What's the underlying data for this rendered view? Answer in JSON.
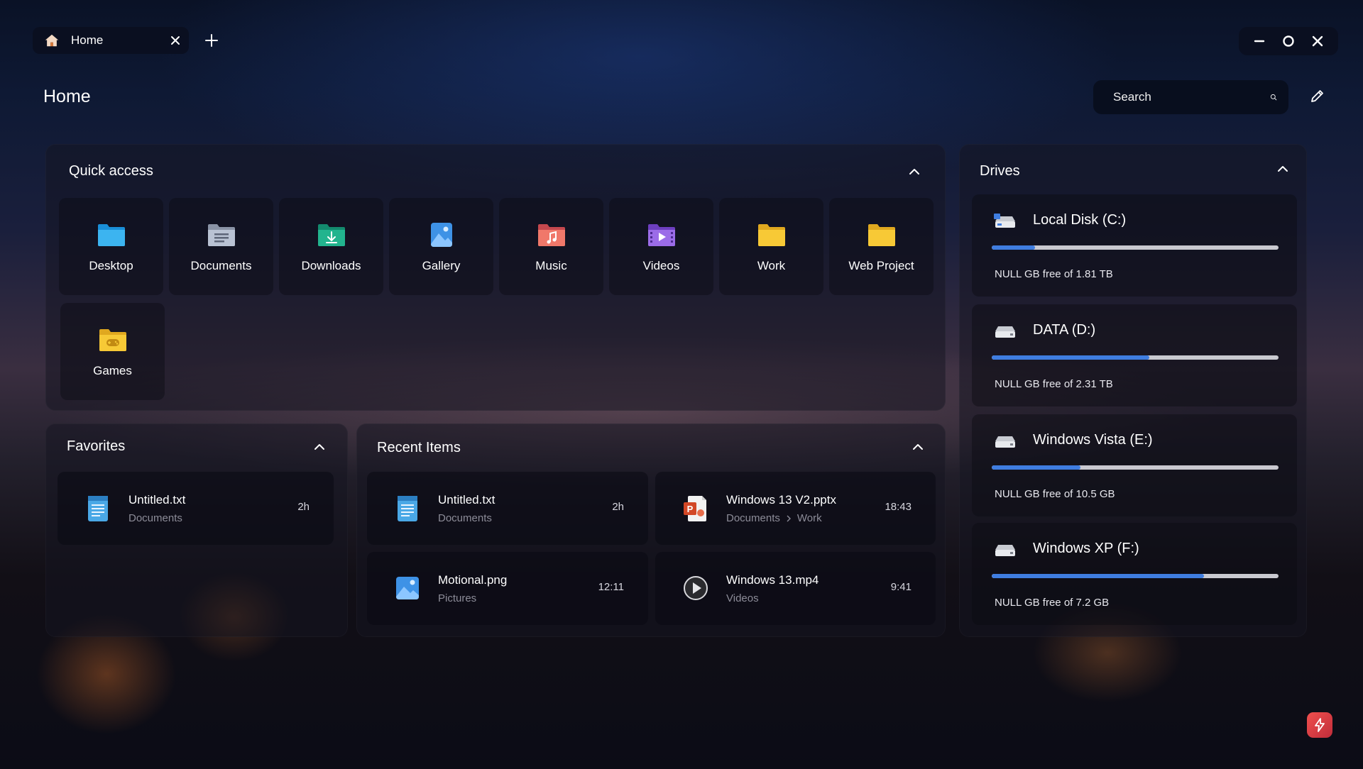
{
  "titlebar": {
    "tab_label": "Home",
    "tab_icon": "home-icon",
    "new_tab_icon": "plus-icon",
    "controls": [
      "minimize-icon",
      "maximize-icon",
      "close-icon"
    ]
  },
  "header": {
    "title": "Home",
    "search_placeholder": "Search",
    "edit_icon": "pencil-icon"
  },
  "quick_access": {
    "title": "Quick access",
    "items": [
      {
        "label": "Desktop",
        "icon": "desktop-folder-icon"
      },
      {
        "label": "Documents",
        "icon": "documents-folder-icon"
      },
      {
        "label": "Downloads",
        "icon": "downloads-folder-icon"
      },
      {
        "label": "Gallery",
        "icon": "gallery-icon"
      },
      {
        "label": "Music",
        "icon": "music-folder-icon"
      },
      {
        "label": "Videos",
        "icon": "videos-folder-icon"
      },
      {
        "label": "Work",
        "icon": "folder-icon"
      },
      {
        "label": "Web Project",
        "icon": "folder-icon"
      },
      {
        "label": "Games",
        "icon": "games-folder-icon"
      }
    ]
  },
  "favorites": {
    "title": "Favorites",
    "items": [
      {
        "name": "Untitled.txt",
        "path": "Documents",
        "time": "2h",
        "icon": "notepad-icon"
      }
    ]
  },
  "recent": {
    "title": "Recent Items",
    "items": [
      {
        "name": "Untitled.txt",
        "path": [
          "Documents"
        ],
        "time": "2h",
        "icon": "notepad-icon"
      },
      {
        "name": "Windows 13 V2.pptx",
        "path": [
          "Documents",
          "Work"
        ],
        "time": "18:43",
        "icon": "powerpoint-icon"
      },
      {
        "name": "Motional.png",
        "path": [
          "Pictures"
        ],
        "time": "12:11",
        "icon": "image-icon"
      },
      {
        "name": "Windows 13.mp4",
        "path": [
          "Videos"
        ],
        "time": "9:41",
        "icon": "play-icon"
      }
    ]
  },
  "drives": {
    "title": "Drives",
    "items": [
      {
        "name": "Local Disk (C:)",
        "free_text": "NULL GB free of 1.81 TB",
        "used_fraction": 0.15,
        "icon": "system-drive-icon"
      },
      {
        "name": "DATA (D:)",
        "free_text": "NULL GB free of 2.31 TB",
        "used_fraction": 0.55,
        "icon": "drive-icon"
      },
      {
        "name": "Windows Vista (E:)",
        "free_text": "NULL GB free of 10.5 GB",
        "used_fraction": 0.31,
        "icon": "drive-icon"
      },
      {
        "name": "Windows XP (F:)",
        "free_text": "NULL GB free of 7.2 GB",
        "used_fraction": 0.74,
        "icon": "drive-icon"
      }
    ]
  },
  "colors": {
    "accent_blue": "#3f7de0",
    "bar_track": "#c9c9d0",
    "folder_yellow": "#f7c936"
  },
  "corner_button_icon": "lightning-icon"
}
